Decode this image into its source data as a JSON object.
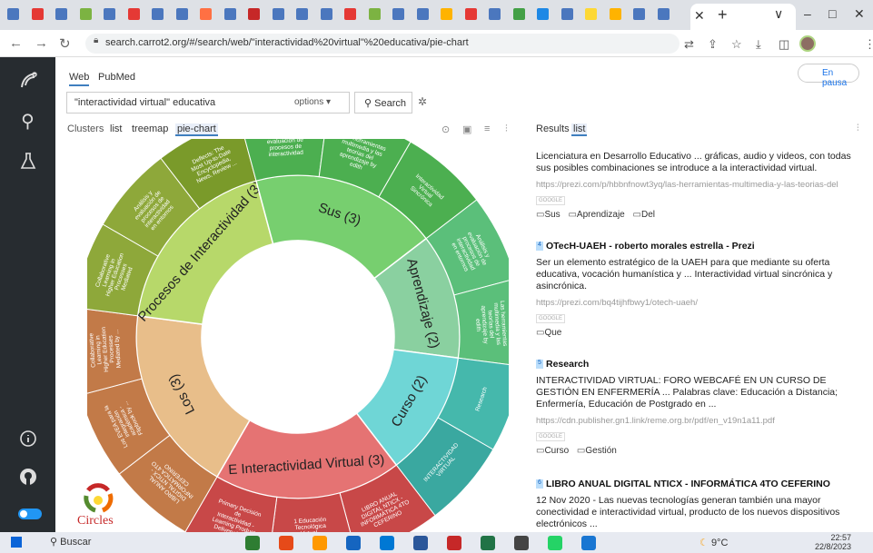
{
  "browser": {
    "tab_favicon_colors": [
      "#4b77be",
      "#e53935",
      "#4b77be",
      "#7cb342",
      "#4b77be",
      "#e53935",
      "#4b77be",
      "#4b77be",
      "#ff7043",
      "#4b77be",
      "#c62828",
      "#4b77be",
      "#4b77be",
      "#4b77be",
      "#e53935",
      "#7cb342",
      "#4b77be",
      "#4b77be",
      "#ffb300",
      "#e53935",
      "#4b77be",
      "#43a047",
      "#1e88e5",
      "#4b77be",
      "#fdd835",
      "#ffb300",
      "#4b77be",
      "#4b77be"
    ],
    "new_tab": "+",
    "window_controls": {
      "minimize": "–",
      "maximize": "□",
      "close": "✕",
      "dropdown": "∨"
    },
    "url": "search.carrot2.org/#/search/web/\"interactividad%20virtual\"%20educativa/pie-chart",
    "profile_label": "En pausa"
  },
  "sidebar": {
    "icons": [
      "carrot-logo-icon",
      "search-icon",
      "flask-icon",
      "info-icon",
      "github-icon",
      "theme-toggle"
    ]
  },
  "search": {
    "sources": [
      "Web",
      "PubMed"
    ],
    "query": "\"interactividad virtual\" educativa",
    "options_label": "options",
    "search_label": "Search"
  },
  "view_tabs": {
    "label": "Clusters",
    "tabs": [
      "list",
      "treemap",
      "pie-chart"
    ],
    "active": "pie-chart"
  },
  "chart_data": {
    "type": "pie",
    "inner_clusters": [
      {
        "label": "Los (3)",
        "color": "#e8be8a",
        "size": 3
      },
      {
        "label": "Procesos de Interactividad (3)",
        "color": "#b7d86a",
        "size": 3
      },
      {
        "label": "Sus (3)",
        "color": "#77cf6f",
        "size": 3
      },
      {
        "label": "Aprendizaje (2)",
        "color": "#8ad0a0",
        "size": 2
      },
      {
        "label": "Curso (2)",
        "color": "#6fd6d6",
        "size": 2
      },
      {
        "label": "E Interactividad Virtual (3)",
        "color": "#e57373",
        "size": 3
      }
    ],
    "outer_docs": [
      {
        "label": "LIBRO ANUAL DIGITAL NTICX - INFORMÁTICA 4TO CEFERINO",
        "color": "#c27a48",
        "cluster": 0
      },
      {
        "label": "Los EVEA para la integración académica - Flipbook by ...",
        "color": "#c27a48",
        "cluster": 0
      },
      {
        "label": "Collaborative Learning in Higher Education Processes Mediated by ...",
        "color": "#c27a48",
        "cluster": 0
      },
      {
        "label": "Collaborative Learning in Higher Education Processes Mediated",
        "color": "#8ea83a",
        "cluster": 1
      },
      {
        "label": "Análisis y evaluación de procesos de interactividad en entornos virtuales de aprendizaje",
        "color": "#8ea83a",
        "cluster": 1
      },
      {
        "label": "Deflects: The Most Up-to-Date Encyclopedia, News, Review ...",
        "color": "#7a9a2a",
        "cluster": 1
      },
      {
        "label": "Análisis y evaluación de procesos de interactividad",
        "color": "#4caf50",
        "cluster": 2
      },
      {
        "label": "Las herramientas multimedia y las teorías del aprendizaje by edith",
        "color": "#4caf50",
        "cluster": 2
      },
      {
        "label": "Interactividad Virtual Sincrónica",
        "color": "#4caf50",
        "cluster": 2
      },
      {
        "label": "Análisis y evaluación de procesos de interactividad en entornos virtuales de aprendizaje",
        "color": "#5bbf7a",
        "cluster": 3
      },
      {
        "label": "Las herramientas multimedia y las teorías del aprendizaje by edith",
        "color": "#5bbf7a",
        "cluster": 3
      },
      {
        "label": "Research",
        "color": "#45b8ac",
        "cluster": 4
      },
      {
        "label": "INTERACTIVIDAD VIRTUAL",
        "color": "#3aa8a0",
        "cluster": 4
      },
      {
        "label": "LIBRO ANUAL DIGITAL NTICX - INFORMÁTICA 4TO CEFERINO",
        "color": "#c84848",
        "cluster": 5
      },
      {
        "label": "1 Educación Tecnológica Virtual - Interactividad",
        "color": "#c84848",
        "cluster": 5
      },
      {
        "label": "Primary Decisión de Interactividad - Learning Product Delivery Level",
        "color": "#c84848",
        "cluster": 5
      }
    ]
  },
  "circles_label": "Circles",
  "results": {
    "label": "Results",
    "tab": "list",
    "items": [
      {
        "num": "",
        "title": "",
        "snippet": "Licenciatura en Desarrollo Educativo ... gráficas, audio y videos, con todas sus posibles combinaciones se introduce a la interactividad virtual.",
        "url": "https://prezi.com/p/hbbnfnowt3yq/las-herramientas-multimedia-y-las-teorias-del",
        "source": "GOOGLE",
        "tags": [
          "Sus",
          "Aprendizaje",
          "Del"
        ]
      },
      {
        "num": "4",
        "title": "OTecH-UAEH - roberto morales estrella - Prezi",
        "snippet": "Ser un elemento estratégico de la UAEH para que mediante su oferta educativa, vocación humanística y ... Interactividad virtual sincrónica y asincrónica.",
        "url": "https://prezi.com/bq4tijhfbwy1/otech-uaeh/",
        "source": "GOOGLE",
        "tags": [
          "Que"
        ]
      },
      {
        "num": "5",
        "title": "Research",
        "snippet": "INTERACTIVIDAD VIRTUAL: FORO WEBCAFÉ EN UN CURSO DE GESTIÓN EN ENFERMERÍA ... Palabras clave: Educación a Distancia; Enfermería, Educación de Postgrado en ...",
        "url": "https://cdn.publisher.gn1.link/reme.org.br/pdf/en_v19n1a11.pdf",
        "source": "GOOGLE",
        "tags": [
          "Curso",
          "Gestión"
        ]
      },
      {
        "num": "6",
        "title": "LIBRO ANUAL DIGITAL NTICX - INFORMÁTICA 4TO CEFERINO",
        "snippet": "12 Nov 2020 - Las nuevas tecnologías generan también una mayor conectividad e interactividad virtual, producto de los nuevos dispositivos electrónicos ...",
        "url": "",
        "source": "",
        "tags": []
      }
    ]
  },
  "taskbar": {
    "search": "Buscar",
    "weather": "9°C",
    "time": "22:57",
    "date": "22/8/2023",
    "app_colors": [
      "#2e7d32",
      "#e64a19",
      "#ff9800",
      "#1565c0",
      "#0078d4",
      "#2b579a",
      "#c62828",
      "#217346",
      "#444",
      "#25d366",
      "#1976d2"
    ]
  }
}
